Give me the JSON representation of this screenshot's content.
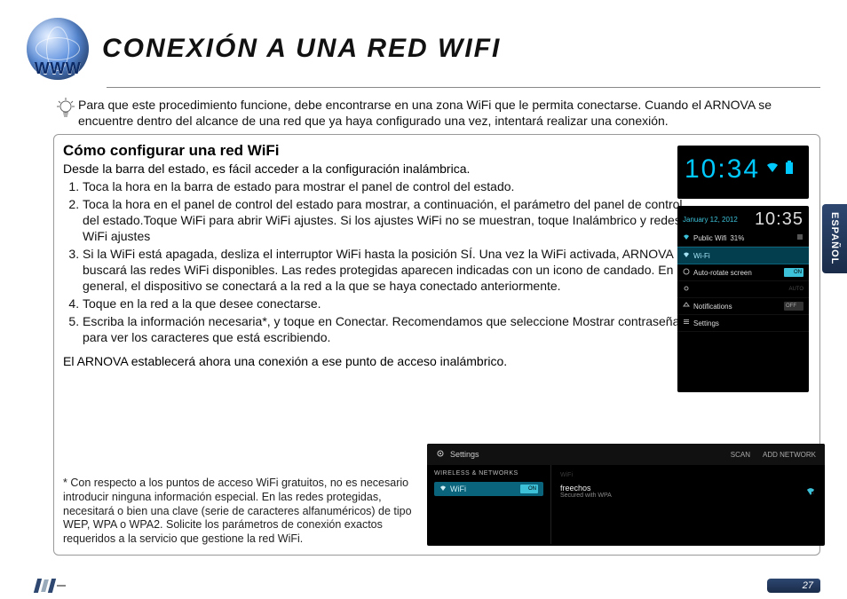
{
  "header": {
    "globe_label": "WWW",
    "title": "CONEXIÓN A UNA RED WIFI"
  },
  "intro": "Para que este procedimiento funcione, debe encontrarse en una zona WiFi que le permita conectarse. Cuando el ARNOVA se encuentre dentro del alcance de una red que ya haya configurado una vez, intentará realizar una conexión.",
  "section": {
    "subtitle": "Cómo configurar una red WiFi",
    "lead": "Desde la barra del estado, es fácil acceder a la configuración inalámbrica.",
    "steps": [
      "Toca la hora en la barra de estado para mostrar el panel de control del estado.",
      "Toca la hora en el panel de control del estado para mostrar, a continuación, el parámetro del panel de control del estado.Toque WiFi para abrir WiFi ajustes. Si los ajustes WiFi no se muestran, toque Inalámbrico y redes> WiFi ajustes",
      "Si la WiFi está apagada, desliza el interruptor WiFi hasta la posición SÍ. Una vez la WiFi activada, ARNOVA buscará las redes WiFi disponibles. Las redes protegidas aparecen indicadas con un icono de candado. En general, el dispositivo se conectará a la red a la que se haya conectado anteriormente.",
      "Toque en la red a la que desee conectarse.",
      "Escriba la información necesaria*, y toque en Conectar. Recomendamos que seleccione Mostrar contraseña para ver los caracteres que está escribiendo."
    ],
    "after": "El ARNOVA establecerá ahora una conexión a ese punto de acceso inalámbrico.",
    "footnote": "* Con respecto a los puntos de acceso WiFi gratuitos, no es necesario introducir ninguna información especial. En las redes protegidas, necesitará o bien una clave (serie de caracteres alfanuméricos) de tipo WEP, WPA o WPA2.  Solicite los parámetros de conexión exactos requeridos a la servicio que gestione la red WiFi."
  },
  "screenshots": {
    "clock_widget": {
      "time": "10:34"
    },
    "status_panel": {
      "date": "January 12, 2012",
      "clock": "10:35",
      "network_name": "Public Wifi",
      "signal": "31%",
      "rows": {
        "wifi": "Wi-Fi",
        "autorotate": "Auto-rotate screen",
        "autorotate_toggle": "ON",
        "brightness_label": "AUTO",
        "notifications": "Notifications",
        "notifications_toggle": "OFF",
        "settings": "Settings"
      }
    },
    "settings": {
      "title": "Settings",
      "actions": {
        "scan": "SCAN",
        "add": "ADD NETWORK"
      },
      "side": {
        "category": "WIRELESS & NETWORKS",
        "wifi": "WiFi",
        "wifi_toggle": "ON"
      },
      "main": {
        "header": "WiFi",
        "network": "freechos",
        "security": "Secured with WPA"
      }
    }
  },
  "side_tab": "ESPAÑOL",
  "page_number": "27"
}
